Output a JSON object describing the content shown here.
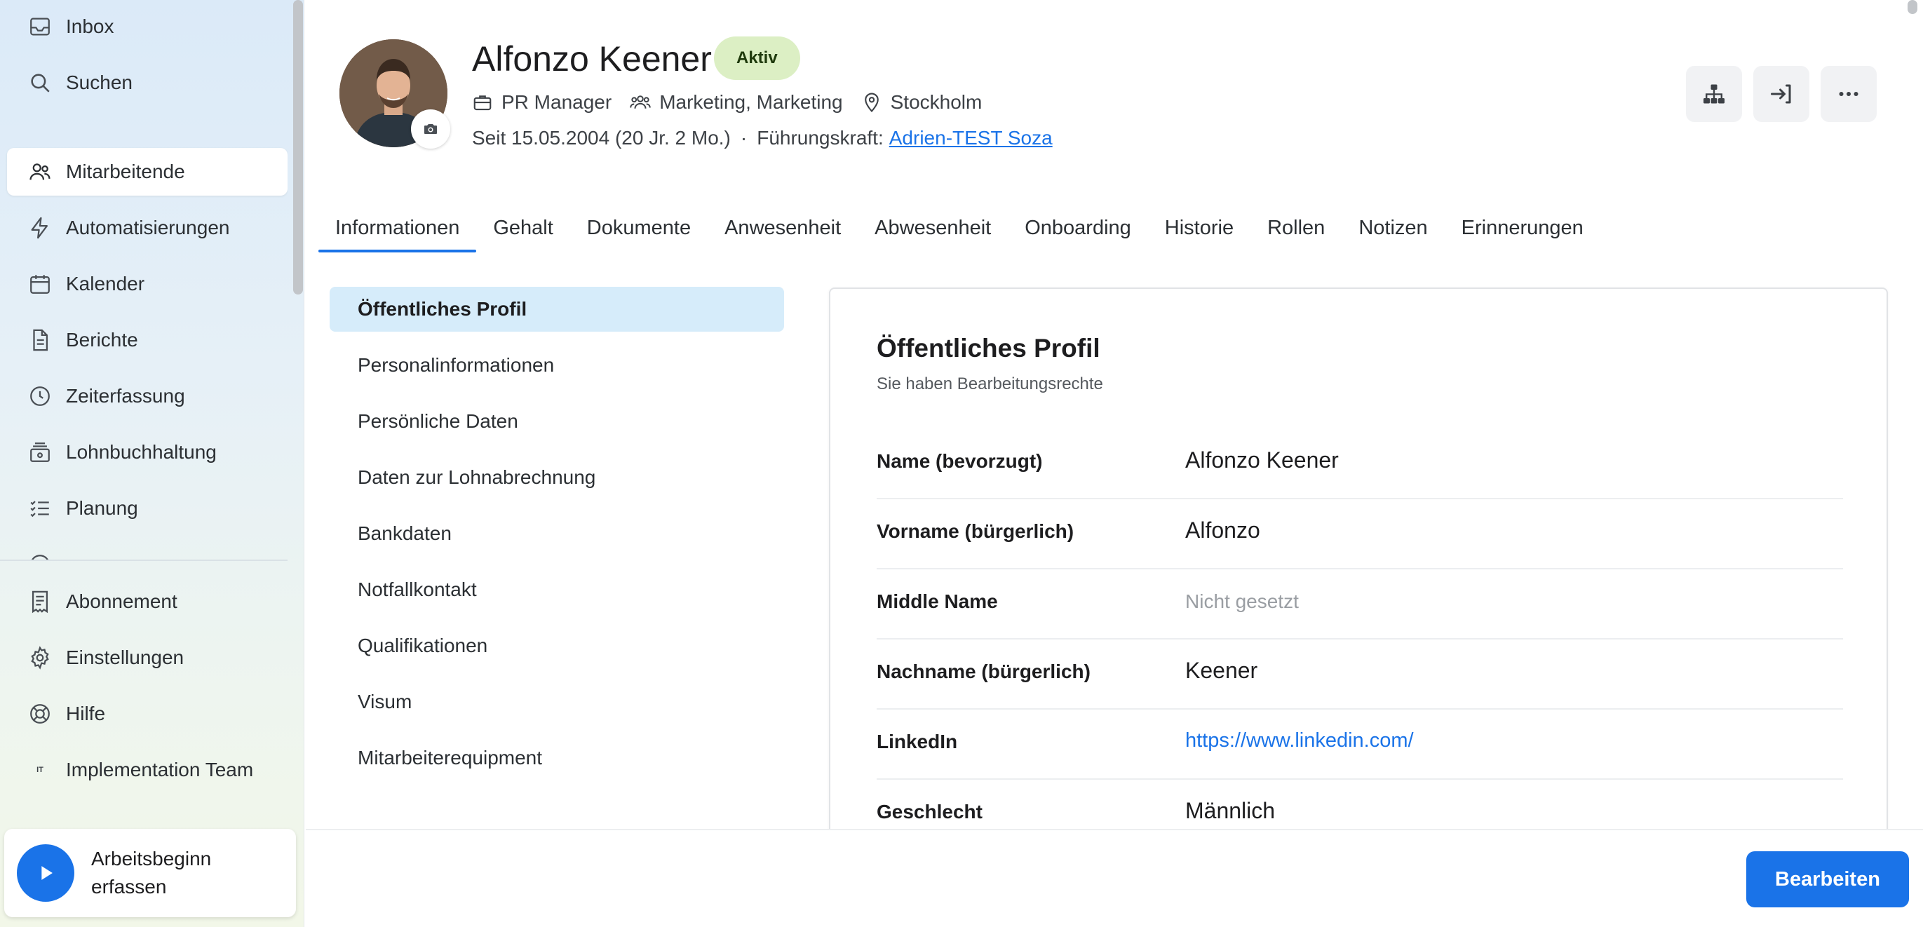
{
  "sidebar": {
    "items": [
      {
        "label": "Inbox",
        "icon": "inbox-icon"
      },
      {
        "label": "Suchen",
        "icon": "search-icon"
      },
      {
        "label": "Mitarbeitende",
        "icon": "users-icon",
        "active": true
      },
      {
        "label": "Automatisierungen",
        "icon": "lightning-icon"
      },
      {
        "label": "Kalender",
        "icon": "calendar-icon"
      },
      {
        "label": "Berichte",
        "icon": "document-icon"
      },
      {
        "label": "Zeiterfassung",
        "icon": "clock-icon"
      },
      {
        "label": "Lohnbuchhaltung",
        "icon": "payroll-icon"
      },
      {
        "label": "Planung",
        "icon": "checklist-icon"
      }
    ],
    "bottom_items": [
      {
        "label": "Abonnement",
        "icon": "receipt-icon"
      },
      {
        "label": "Einstellungen",
        "icon": "gear-icon"
      },
      {
        "label": "Hilfe",
        "icon": "lifebuoy-icon"
      },
      {
        "label": "Implementation Team",
        "badge": "IT"
      }
    ],
    "work_start": {
      "label": "Arbeitsbeginn erfassen",
      "icon": "play-icon"
    }
  },
  "employee": {
    "name": "Alfonzo Keener",
    "status": "Aktiv",
    "role": "PR Manager",
    "departments": "Marketing, Marketing",
    "location": "Stockholm",
    "since": "Seit 15.05.2004 (20 Jr. 2 Mo.)",
    "separator": "·",
    "manager_label": "Führungskraft:",
    "manager_name": "Adrien-TEST Soza"
  },
  "actions": [
    {
      "name": "org-chart-button",
      "icon": "org-chart-icon"
    },
    {
      "name": "login-as-button",
      "icon": "login-icon"
    },
    {
      "name": "more-button",
      "icon": "more-icon"
    }
  ],
  "tabs": [
    {
      "label": "Informationen",
      "active": true
    },
    {
      "label": "Gehalt"
    },
    {
      "label": "Dokumente"
    },
    {
      "label": "Anwesenheit"
    },
    {
      "label": "Abwesenheit"
    },
    {
      "label": "Onboarding"
    },
    {
      "label": "Historie"
    },
    {
      "label": "Rollen"
    },
    {
      "label": "Notizen"
    },
    {
      "label": "Erinnerungen"
    }
  ],
  "sections": [
    {
      "label": "Öffentliches Profil",
      "active": true
    },
    {
      "label": "Personalinformationen"
    },
    {
      "label": "Persönliche Daten"
    },
    {
      "label": "Daten zur Lohnabrechnung"
    },
    {
      "label": "Bankdaten"
    },
    {
      "label": "Notfallkontakt"
    },
    {
      "label": "Qualifikationen"
    },
    {
      "label": "Visum"
    },
    {
      "label": "Mitarbeiterequipment"
    }
  ],
  "card": {
    "title": "Öffentliches Profil",
    "subtitle": "Sie haben Bearbeitungsrechte",
    "fields": [
      {
        "label": "Name (bevorzugt)",
        "value": "Alfonzo Keener"
      },
      {
        "label": "Vorname (bürgerlich)",
        "value": "Alfonzo"
      },
      {
        "label": "Middle Name",
        "value": "Nicht gesetzt",
        "muted": true
      },
      {
        "label": "Nachname (bürgerlich)",
        "value": "Keener"
      },
      {
        "label": "LinkedIn",
        "value": "https://www.linkedin.com/",
        "link": true
      },
      {
        "label": "Geschlecht",
        "value": "Männlich"
      }
    ]
  },
  "edit_button": "Bearbeiten",
  "colors": {
    "accent": "#1a73e8",
    "status_bg": "#dcefc4",
    "active_section_bg": "#d6ecfa"
  }
}
